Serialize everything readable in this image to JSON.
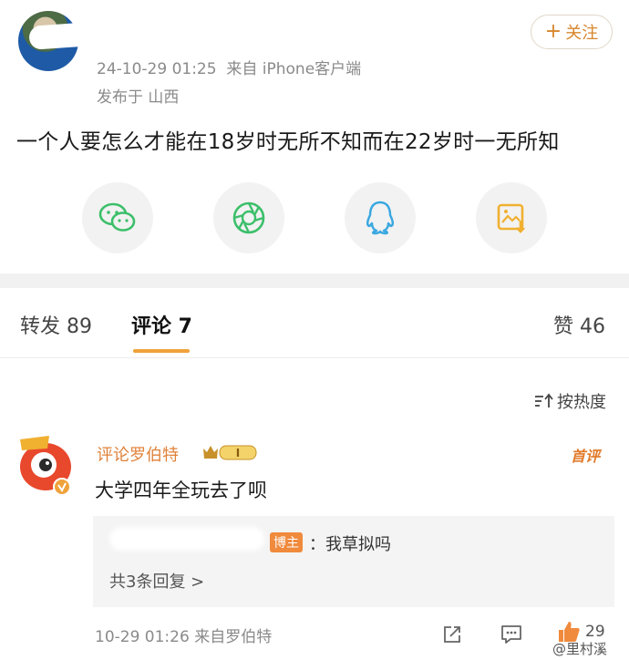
{
  "post": {
    "time": "24-10-29 01:25",
    "source": "来自 iPhone客户端",
    "location": "发布于 山西",
    "follow_label": "关注",
    "text": "一个人要怎么才能在18岁时无所不知而在22岁时一无所知"
  },
  "share": [
    {
      "name": "wechat",
      "icon": "wechat-icon",
      "color": "#3cbf6a"
    },
    {
      "name": "moments",
      "icon": "moments-icon",
      "color": "#3cbf6a"
    },
    {
      "name": "qq",
      "icon": "qq-icon",
      "color": "#3aa8e0"
    },
    {
      "name": "save-image",
      "icon": "save-image-icon",
      "color": "#f0b030"
    }
  ],
  "tabs": {
    "repost": "转发 89",
    "comments": "评论 7",
    "likes": "赞 46"
  },
  "sort_label": "按热度",
  "comment": {
    "author": "评论罗伯特",
    "badge_level": "I",
    "first_label": "首评",
    "text": "大学四年全玩去了呗",
    "reply": {
      "tag": "博主",
      "text": "：我草拟吗",
      "more": "共3条回复 >"
    },
    "footer": "10-29 01:26  来自罗伯特",
    "like_count": "29"
  },
  "watermark": "@里村溪",
  "colors": {
    "accent": "#f0a23a",
    "comment_name": "#e0823a",
    "blogger_tag": "#f08a3c"
  }
}
